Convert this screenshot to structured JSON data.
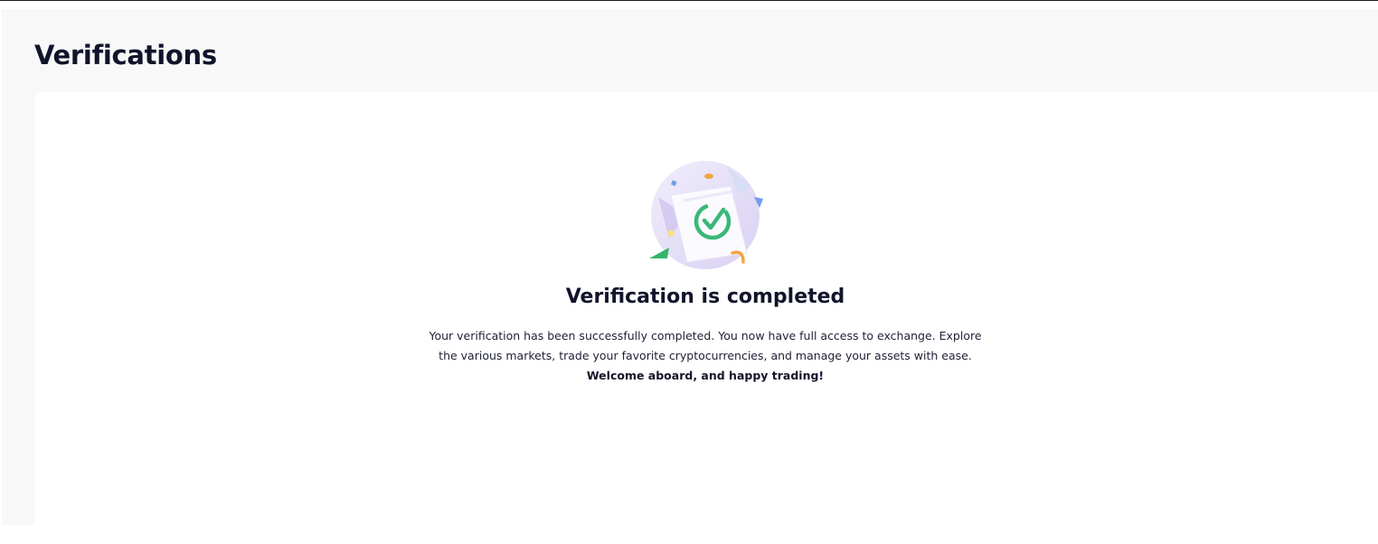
{
  "page": {
    "title": "Verifications"
  },
  "status": {
    "title": "Verification is completed",
    "description": "Your verification has been successfully completed. You now have full access to exchange. Explore the various markets, trade your favorite cryptocurrencies, and manage your assets with ease.",
    "welcome": "Welcome aboard, and happy trading!",
    "icon": "verified-document-icon"
  },
  "colors": {
    "title": "#12142b",
    "success": "#3ab878",
    "illustration_bg": "#e7e2f7",
    "confetti_orange": "#f2a540",
    "confetti_blue": "#6f9ee8",
    "confetti_green": "#34b56e"
  }
}
